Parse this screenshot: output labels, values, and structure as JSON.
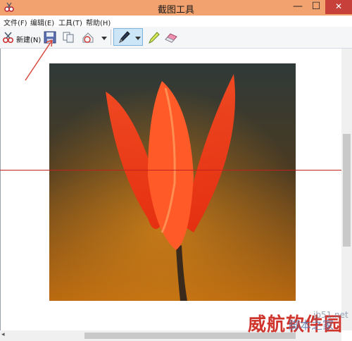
{
  "window": {
    "title": "截图工具",
    "close": "✕",
    "minimize": "—",
    "maximize": "☐"
  },
  "menu": [
    {
      "label": "文件(F)"
    },
    {
      "label": "编辑(E)"
    },
    {
      "label": "工具(T)"
    },
    {
      "label": "帮助(H)"
    }
  ],
  "toolbar": {
    "new_label": "新建(N)"
  },
  "scrollbar": {
    "left_arrow": "◂"
  },
  "watermark": {
    "brand": "威航软件园",
    "site": "脚本之家",
    "domain": "jb51.net"
  },
  "colors": {
    "titlebar": "#f2a26f",
    "close": "#c7403a",
    "guide_line": "#c0201e",
    "annotation_arrow": "#d9473a"
  }
}
